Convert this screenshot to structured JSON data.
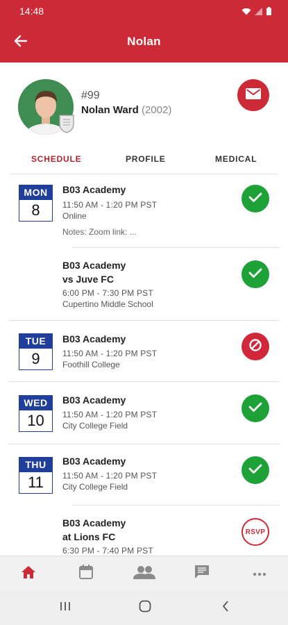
{
  "status_bar": {
    "time": "14:48"
  },
  "app_bar": {
    "title": "Nolan"
  },
  "profile": {
    "jersey": "#99",
    "name": "Nolan Ward",
    "year": "(2002)"
  },
  "tabs": [
    {
      "label": "SCHEDULE",
      "active": true
    },
    {
      "label": "PROFILE",
      "active": false
    },
    {
      "label": "MEDICAL",
      "active": false
    }
  ],
  "events": [
    {
      "dow": "MON",
      "day": "8",
      "title": "B03 Academy",
      "opponent": "",
      "time": "11:50 AM - 1:20 PM   PST",
      "location": "Online",
      "notes": "Notes: Zoom link:  ...",
      "status": "confirmed"
    },
    {
      "dow": "",
      "day": "",
      "title": "B03 Academy",
      "opponent": "vs  Juve FC",
      "time": "6:00 PM - 7:30 PM   PST",
      "location": "Cupertino Middle School",
      "notes": "",
      "status": "confirmed"
    },
    {
      "dow": "TUE",
      "day": "9",
      "title": "B03 Academy",
      "opponent": "",
      "time": "11:50 AM - 1:20 PM   PST",
      "location": "Foothill College",
      "notes": "",
      "status": "declined"
    },
    {
      "dow": "WED",
      "day": "10",
      "title": "B03 Academy",
      "opponent": "",
      "time": "11:50 AM - 1:20 PM   PST",
      "location": "City College Field",
      "notes": "",
      "status": "confirmed"
    },
    {
      "dow": "THU",
      "day": "11",
      "title": "B03 Academy",
      "opponent": "",
      "time": "11:50 AM - 1:20 PM   PST",
      "location": "City College Field",
      "notes": "",
      "status": "confirmed"
    },
    {
      "dow": "",
      "day": "",
      "title": "B03 Academy",
      "opponent": "at  Lions FC",
      "time": "6:30 PM - 7:40 PM   PST",
      "location": "",
      "notes": "",
      "status": "rsvp",
      "status_label": "RSVP"
    }
  ],
  "colors": {
    "brand": "#cc2a36",
    "date_blue": "#1f3f9a",
    "confirmed": "#1ea238",
    "declined": "#d0283a"
  },
  "icons": {
    "appbar": [
      "back-arrow-icon"
    ],
    "profile": [
      "mail-icon"
    ],
    "bottom_nav": [
      "home-icon",
      "calendar-icon",
      "people-icon",
      "chat-icon",
      "more-icon"
    ],
    "system_nav": [
      "recents-icon",
      "home-circle-icon",
      "back-chevron-icon"
    ]
  }
}
